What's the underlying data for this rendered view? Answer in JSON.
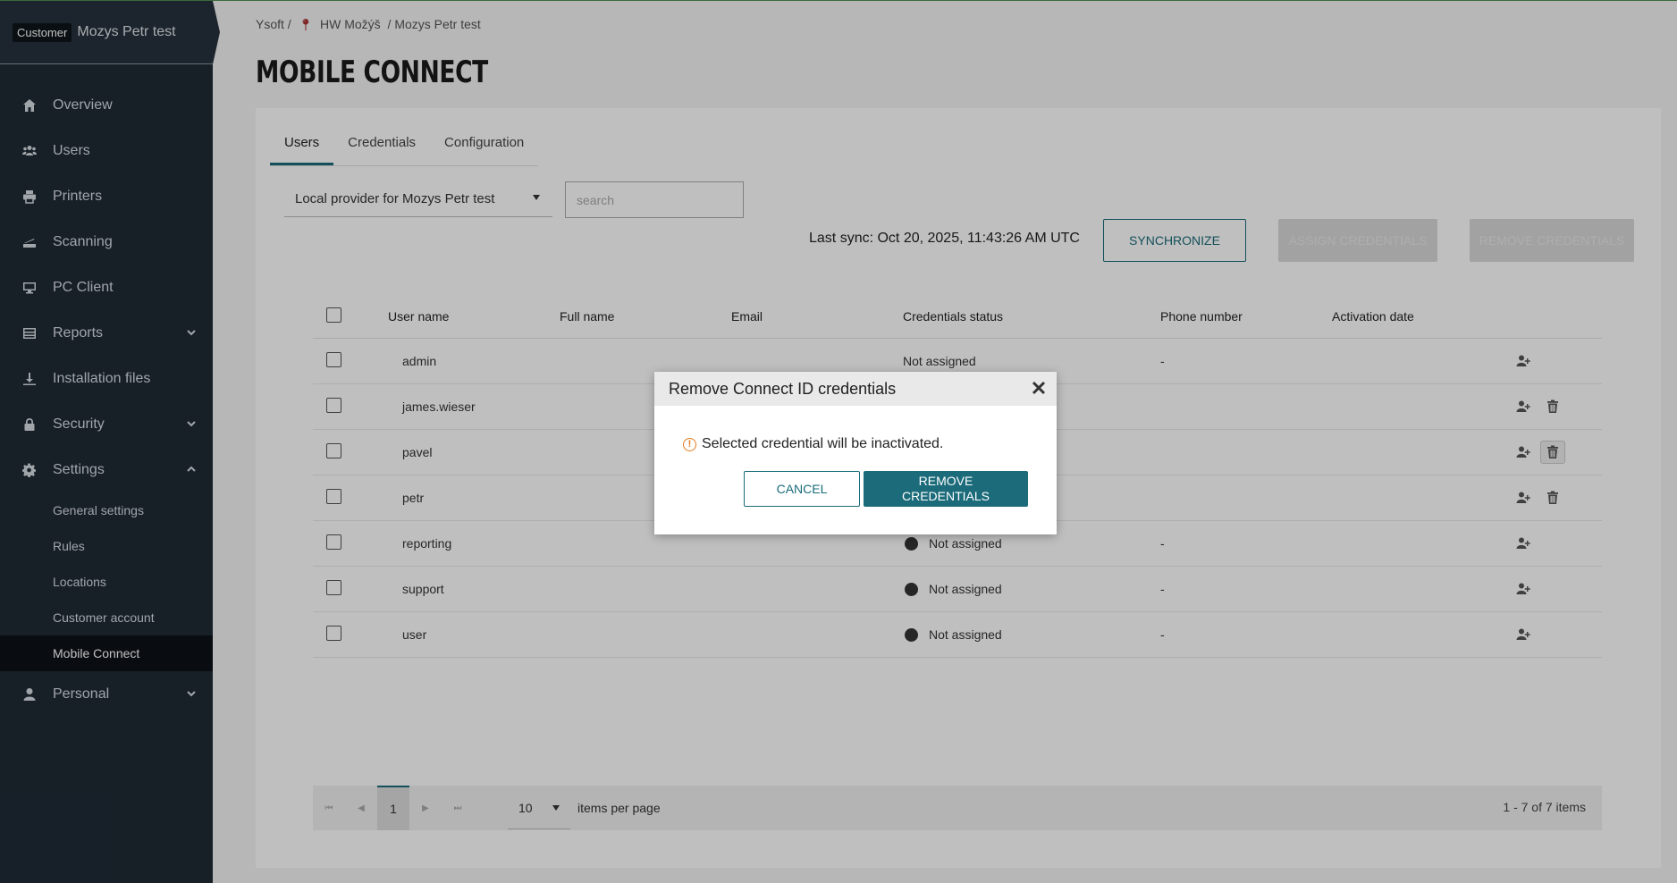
{
  "sidebar": {
    "customer_badge": "Customer",
    "customer_name": "Mozys Petr test",
    "items": [
      {
        "label": "Overview",
        "icon": "home-icon"
      },
      {
        "label": "Users",
        "icon": "users-icon"
      },
      {
        "label": "Printers",
        "icon": "printer-icon"
      },
      {
        "label": "Scanning",
        "icon": "scanner-icon"
      },
      {
        "label": "PC Client",
        "icon": "monitor-icon"
      },
      {
        "label": "Reports",
        "icon": "reports-icon"
      },
      {
        "label": "Installation files",
        "icon": "download-icon"
      },
      {
        "label": "Security",
        "icon": "lock-icon"
      },
      {
        "label": "Settings",
        "icon": "gear-icon"
      },
      {
        "label": "Personal",
        "icon": "person-icon"
      }
    ],
    "settings_sub": [
      {
        "label": "General settings"
      },
      {
        "label": "Rules"
      },
      {
        "label": "Locations"
      },
      {
        "label": "Customer account"
      },
      {
        "label": "Mobile Connect"
      }
    ]
  },
  "breadcrumb": {
    "root": "Ysoft /",
    "location": "HW Možýš",
    "current": "/ Mozys Petr test"
  },
  "page_title": "MOBILE CONNECT",
  "tabs": [
    {
      "label": "Users"
    },
    {
      "label": "Credentials"
    },
    {
      "label": "Configuration"
    }
  ],
  "provider_select": "Local provider for Mozys Petr test",
  "search": {
    "placeholder": "search"
  },
  "last_sync": "Last sync: Oct 20, 2025, 11:43:26 AM UTC",
  "buttons": {
    "synchronize": "SYNCHRONIZE",
    "assign": "ASSIGN CREDENTIALS",
    "remove": "REMOVE CREDENTIALS"
  },
  "table": {
    "headers": [
      "User name",
      "Full name",
      "Email",
      "Credentials status",
      "Phone number",
      "Activation date"
    ],
    "rows": [
      {
        "user": "admin",
        "status": "Not assigned",
        "phone": "-"
      },
      {
        "user": "james.wieser",
        "status": "",
        "phone": ""
      },
      {
        "user": "pavel",
        "status": "",
        "phone": ""
      },
      {
        "user": "petr",
        "status": "",
        "phone": ""
      },
      {
        "user": "reporting",
        "status": "Not assigned",
        "phone": "-"
      },
      {
        "user": "support",
        "status": "Not assigned",
        "phone": "-"
      },
      {
        "user": "user",
        "status": "Not assigned",
        "phone": "-"
      }
    ]
  },
  "pager": {
    "current_page": "1",
    "page_size": "10",
    "items_per_page": "items per page",
    "info": "1 - 7 of 7 items"
  },
  "dialog": {
    "title": "Remove Connect ID credentials",
    "message": "Selected credential will be inactivated.",
    "cancel": "CANCEL",
    "confirm": "REMOVE CREDENTIALS"
  },
  "colors": {
    "accent": "#1b6b7a",
    "sidebar": "#1f2b35",
    "warning": "#e07a1a"
  }
}
